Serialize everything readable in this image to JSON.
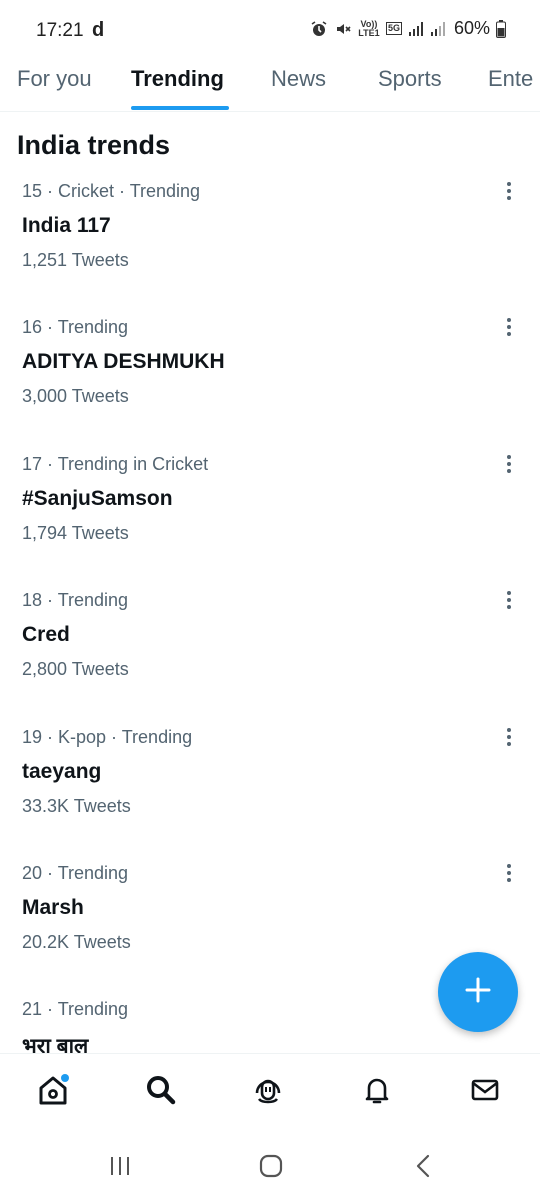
{
  "status_bar": {
    "time": "17:21",
    "carrier_glyph": "d",
    "volte_label": "Vo)) LTE1",
    "network_label": "5G",
    "battery": "60%",
    "icons": [
      "alarm-icon",
      "mute-icon",
      "signal-icon",
      "battery-icon"
    ]
  },
  "tabs": [
    {
      "label": "For you",
      "active": false
    },
    {
      "label": "Trending",
      "active": true
    },
    {
      "label": "News",
      "active": false
    },
    {
      "label": "Sports",
      "active": false
    },
    {
      "label": "Ente",
      "active": false
    }
  ],
  "section_title": "India trends",
  "trends": [
    {
      "meta": "15 · Cricket · Trending",
      "name": "India 117",
      "count": "1,251 Tweets"
    },
    {
      "meta": "16 · Trending",
      "name": "ADITYA DESHMUKH",
      "count": "3,000 Tweets"
    },
    {
      "meta": "17 · Trending in Cricket",
      "name": "#SanjuSamson",
      "count": "1,794 Tweets"
    },
    {
      "meta": "18 · Trending",
      "name": "Cred",
      "count": "2,800 Tweets"
    },
    {
      "meta": "19 · K-pop · Trending",
      "name": "taeyang",
      "count": "33.3K Tweets"
    },
    {
      "meta": "20 · Trending",
      "name": "Marsh",
      "count": "20.2K Tweets"
    },
    {
      "meta": "21 · Trending",
      "name": "भरा बाल",
      "count": ""
    }
  ],
  "colors": {
    "accent": "#1d9bf0",
    "text_primary": "#0f1419",
    "text_secondary": "#536471"
  },
  "bottom_nav": [
    "home-icon",
    "search-icon",
    "spaces-icon",
    "notifications-icon",
    "messages-icon"
  ],
  "system_nav": [
    "recents-icon",
    "home-circle-icon",
    "back-icon"
  ]
}
